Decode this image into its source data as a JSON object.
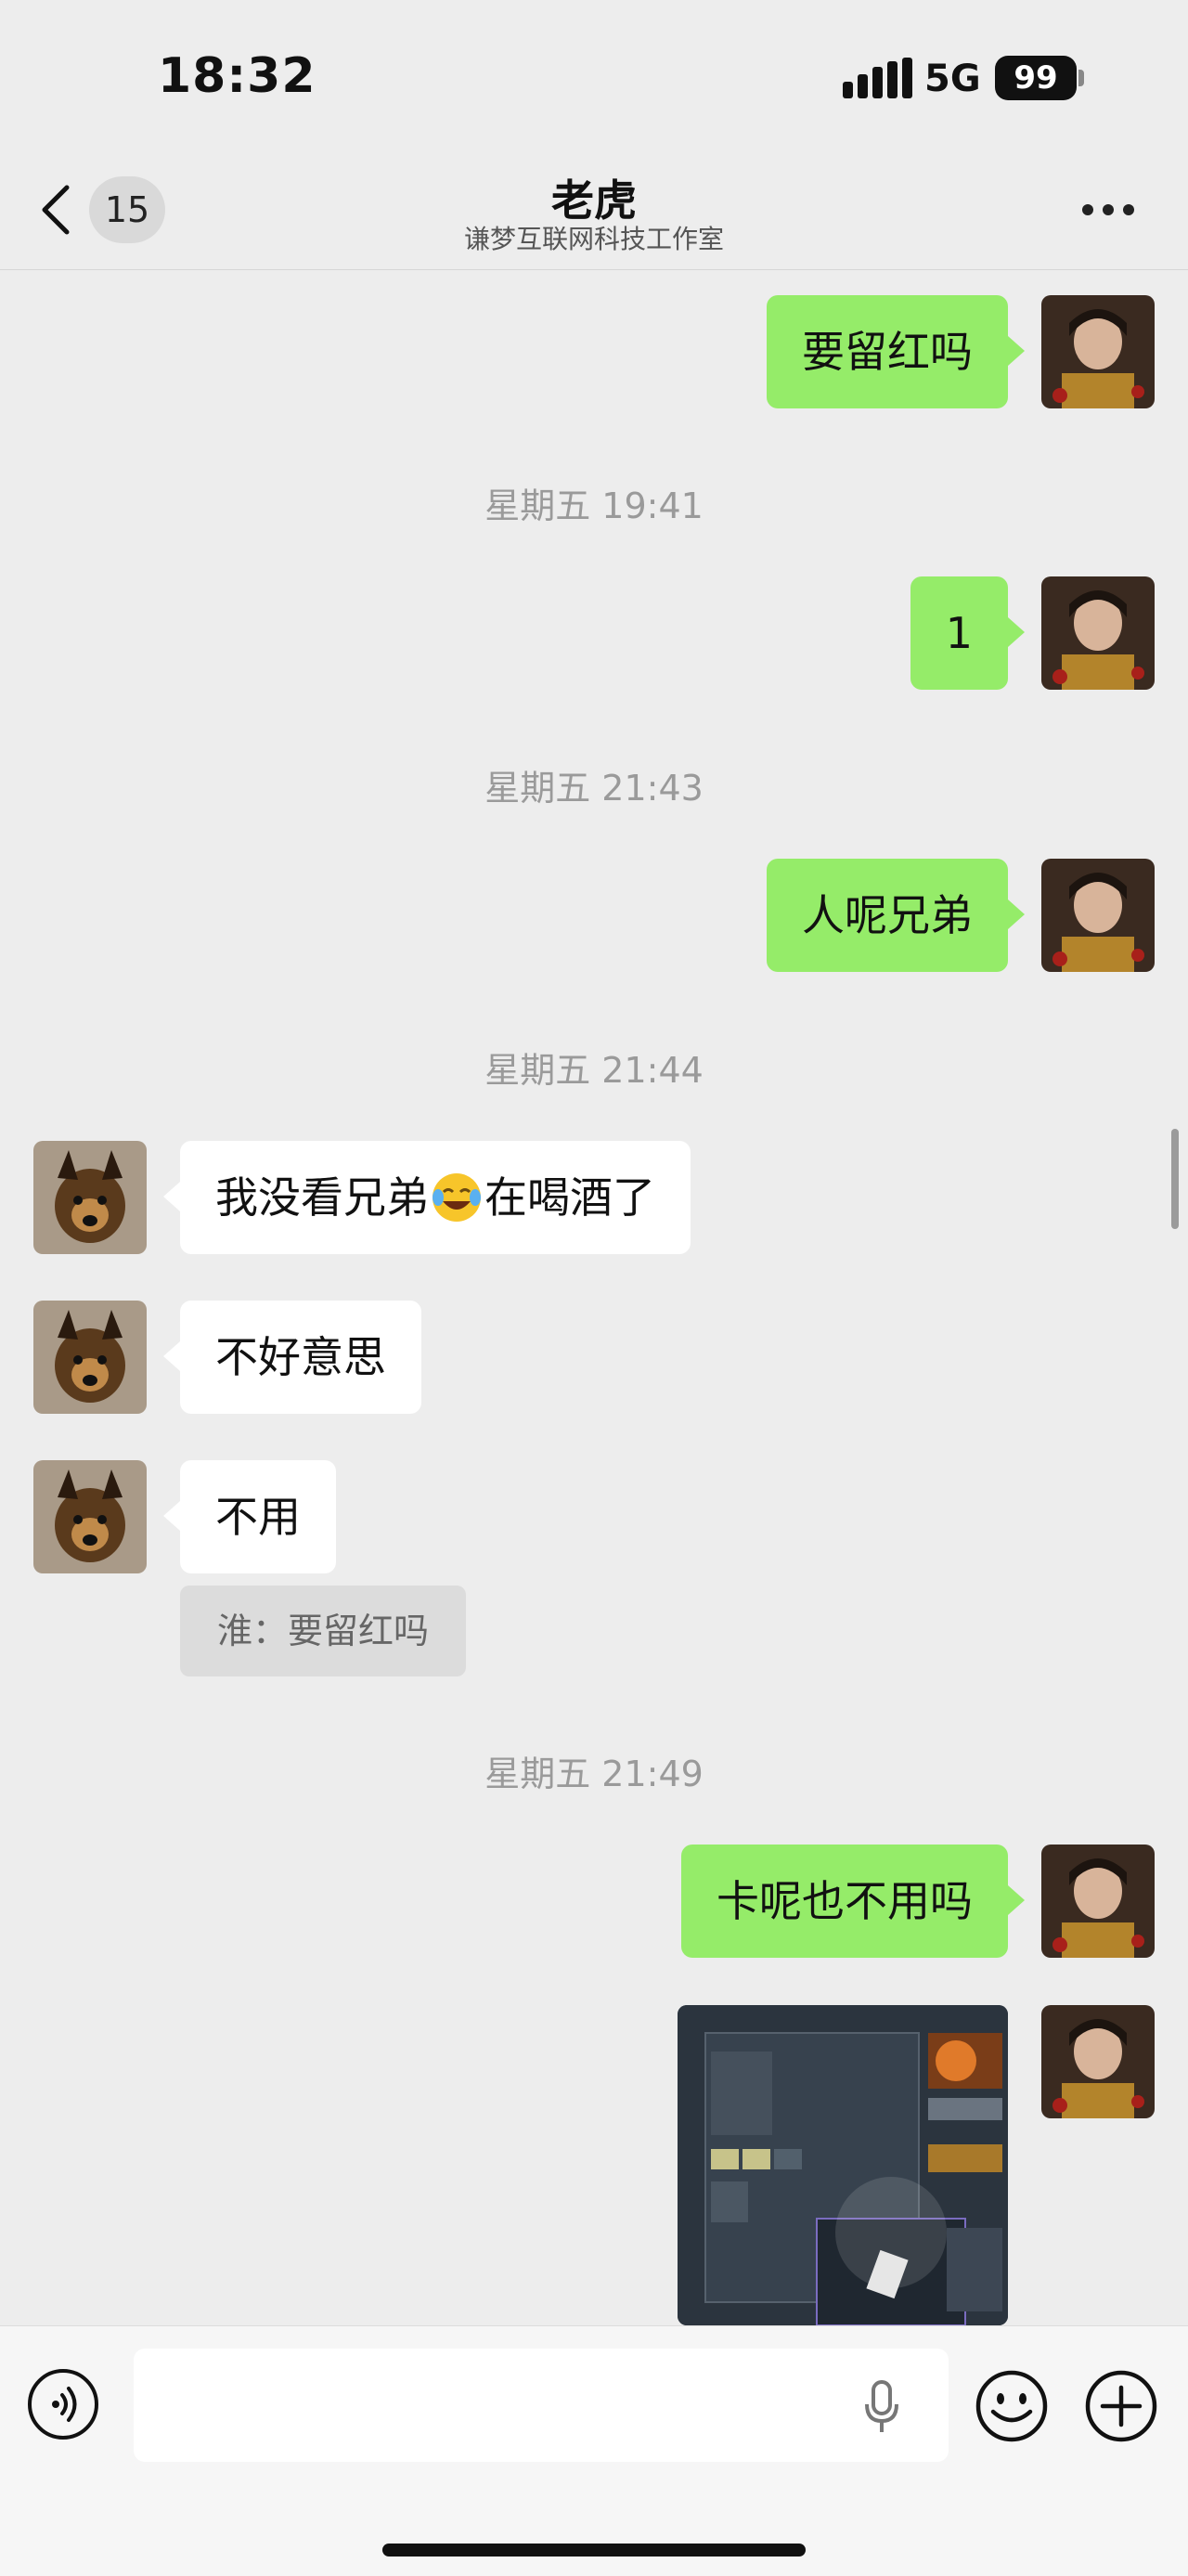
{
  "status_bar": {
    "time": "18:32",
    "network": "5G",
    "battery": "99"
  },
  "nav": {
    "back_count": "15",
    "title": "老虎",
    "subtitle": "谦梦互联网科技工作室"
  },
  "timestamps": [
    "星期五 19:41",
    "星期五 21:43",
    "星期五 21:44",
    "星期五 21:49"
  ],
  "messages": [
    {
      "from": "me",
      "text": "要留红吗"
    },
    {
      "from": "me",
      "text": "1"
    },
    {
      "from": "me",
      "text": "人呢兄弟"
    },
    {
      "from": "them",
      "text_before": "我没看兄弟",
      "emoji": "laughing-tears-emoji",
      "text_after": "在喝酒了"
    },
    {
      "from": "them",
      "text": "不好意思"
    },
    {
      "from": "them",
      "text": "不用"
    },
    {
      "from": "me",
      "text": "卡呢也不用吗"
    },
    {
      "from": "me",
      "type": "image",
      "description": "game inventory screenshot"
    }
  ],
  "quote": {
    "text": "淮：要留红吗"
  },
  "input": {
    "value": "",
    "placeholder": ""
  },
  "colors": {
    "background": "#ededed",
    "my_bubble": "#95ec69",
    "their_bubble": "#ffffff"
  },
  "icons": [
    "back-icon",
    "more-icon",
    "voice-icon",
    "microphone-icon",
    "emoji-icon",
    "plus-icon"
  ]
}
